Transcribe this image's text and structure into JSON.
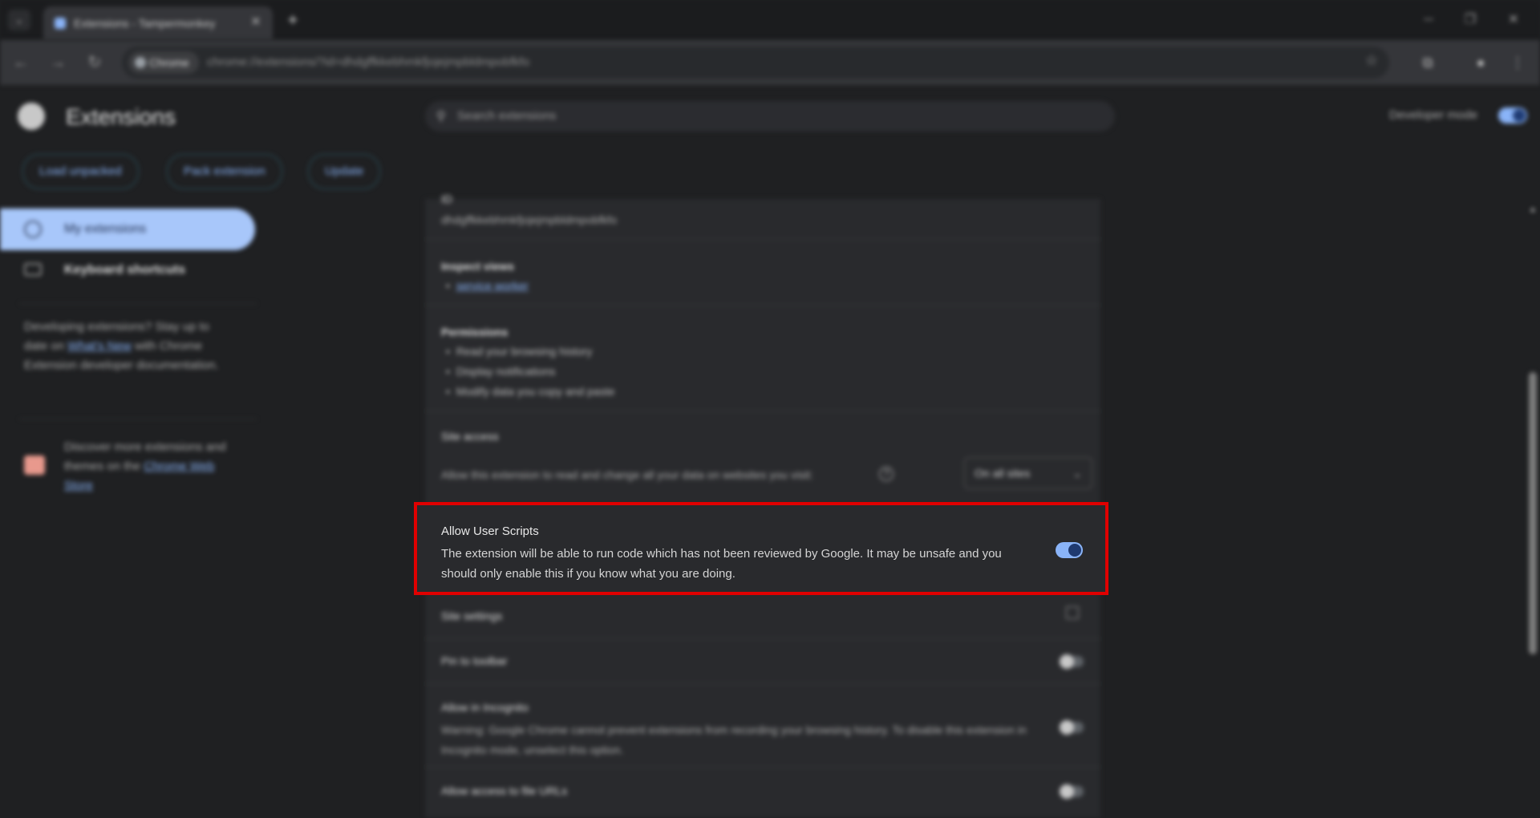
{
  "browser": {
    "tab_title": "Extensions - Tampermonkey",
    "omnibox_chip": "Chrome",
    "url": "chrome://extensions/?id=dhdgffkkebhmkfjojejmpbldmpobfkfo"
  },
  "header": {
    "title": "Extensions",
    "search_placeholder": "Search extensions",
    "developer_mode_label": "Developer mode"
  },
  "actions": {
    "load_unpacked": "Load unpacked",
    "pack_extension": "Pack extension",
    "update": "Update"
  },
  "sidebar": {
    "my_extensions": "My extensions",
    "keyboard_shortcuts": "Keyboard shortcuts",
    "dev_note_prefix": "Developing extensions? Stay up to date on",
    "dev_note_link": "What's New",
    "dev_note_suffix": "with Chrome Extension developer documentation.",
    "store_note_prefix": "Discover more extensions and themes on the",
    "store_note_link": "Chrome Web Store"
  },
  "details": {
    "id_label": "ID",
    "id_value": "dhdgffkkebhmkfjojejmpbldmpobfkfo",
    "inspect_views_label": "Inspect views",
    "inspect_views_link": "service worker",
    "permissions_label": "Permissions",
    "permissions": [
      "Read your browsing history",
      "Display notifications",
      "Modify data you copy and paste"
    ],
    "site_access_label": "Site access",
    "site_access_desc": "Allow this extension to read and change all your data on websites you visit:",
    "site_access_value": "On all sites",
    "allow_user_scripts_title": "Allow User Scripts",
    "allow_user_scripts_desc": "The extension will be able to run code which has not been reviewed by Google. It may be unsafe and you should only enable this if you know what you are doing.",
    "allow_user_scripts_enabled": true,
    "site_settings_label": "Site settings",
    "pin_to_toolbar_label": "Pin to toolbar",
    "allow_incognito_label": "Allow in Incognito",
    "allow_incognito_desc": "Warning: Google Chrome cannot prevent extensions from recording your browsing history. To disable this extension in Incognito mode, unselect this option.",
    "file_urls_label": "Allow access to file URLs"
  },
  "colors": {
    "accent": "#8ab4f8",
    "highlight_border": "#e00000"
  }
}
